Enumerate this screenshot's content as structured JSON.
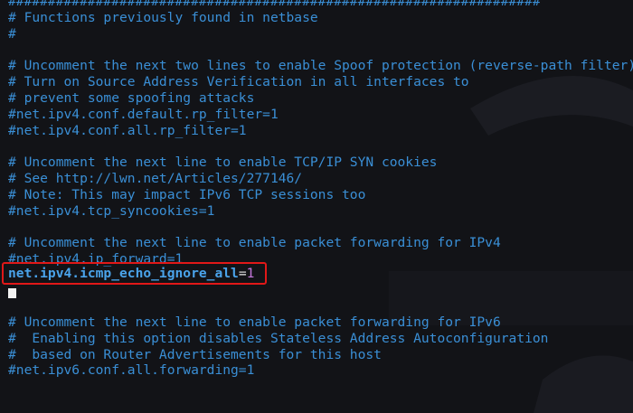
{
  "editor": {
    "lines": [
      "###################################################################",
      "# Functions previously found in netbase",
      "#",
      "",
      "# Uncomment the next two lines to enable Spoof protection (reverse-path filter)",
      "# Turn on Source Address Verification in all interfaces to",
      "# prevent some spoofing attacks",
      "#net.ipv4.conf.default.rp_filter=1",
      "#net.ipv4.conf.all.rp_filter=1",
      "",
      "# Uncomment the next line to enable TCP/IP SYN cookies",
      "# See http://lwn.net/Articles/277146/",
      "# Note: This may impact IPv6 TCP sessions too",
      "#net.ipv4.tcp_syncookies=1",
      "",
      "# Uncomment the next line to enable packet forwarding for IPv4",
      "#net.ipv4.ip_forward=1"
    ],
    "active_line": {
      "key": "net.ipv4.icmp_echo_ignore_all",
      "operator": "=",
      "value": "1"
    },
    "lines_after": [
      "",
      "# Uncomment the next line to enable packet forwarding for IPv6",
      "#  Enabling this option disables Stateless Address Autoconfiguration",
      "#  based on Router Advertisements for this host",
      "#net.ipv6.conf.all.forwarding=1"
    ]
  },
  "colors": {
    "background": "#121317",
    "comment_text": "#3a8fd6",
    "highlight_border": "#e11818",
    "value_number": "#c678dd",
    "cursor": "#f2f2f2"
  }
}
